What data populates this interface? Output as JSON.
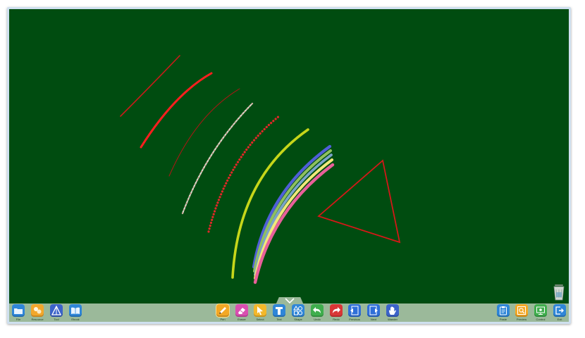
{
  "app": {
    "board_color": "#004c10",
    "toolbar_color": "#9bb99a"
  },
  "toolbar": {
    "left": [
      {
        "label": "File",
        "icon": "folder-icon",
        "color": "#2f86d8"
      },
      {
        "label": "Resource",
        "icon": "resource-icon",
        "color": "#f2a72b"
      },
      {
        "label": "Tool",
        "icon": "ruler-triangle-icon",
        "color": "#3b63c9"
      },
      {
        "label": "Ebook",
        "icon": "open-book-icon",
        "color": "#2f86d8"
      }
    ],
    "center": [
      {
        "label": "Pen",
        "icon": "pencil-icon",
        "color": "#f3a825",
        "active": true
      },
      {
        "label": "Eraser",
        "icon": "eraser-icon",
        "color": "#d94fb0"
      },
      {
        "label": "Select",
        "icon": "cursor-icon",
        "color": "#f3b82a"
      },
      {
        "label": "Text",
        "icon": "text-t-icon",
        "color": "#2f86d8"
      },
      {
        "label": "Shape",
        "icon": "shapes-icon",
        "color": "#2f86d8"
      },
      {
        "label": "Undo",
        "icon": "undo-arrow-icon",
        "color": "#3fae4d"
      },
      {
        "label": "Redo",
        "icon": "redo-arrow-icon",
        "color": "#d93636"
      },
      {
        "label": "Previous",
        "icon": "previous-page-icon",
        "color": "#2f6fd8"
      },
      {
        "label": "Next",
        "icon": "next-page-icon",
        "color": "#2f6fd8"
      },
      {
        "label": "Wander",
        "icon": "hand-icon",
        "color": "#3b63c9"
      }
    ],
    "right": [
      {
        "label": "Paste",
        "icon": "clipboard-icon",
        "color": "#2f86d8"
      },
      {
        "label": "Preview",
        "icon": "magnifier-page-icon",
        "color": "#f3a825"
      },
      {
        "label": "Control",
        "icon": "control-icon",
        "color": "#3fae4d"
      },
      {
        "label": "Exit",
        "icon": "exit-arrow-icon",
        "color": "#2f86d8"
      }
    ]
  },
  "strokes": {
    "colors": [
      "#cc1a1a",
      "#ff1e1e",
      "#b01515",
      "#d8d8c8",
      "#e02828",
      "#c6d61a",
      "#4f5fd8",
      "#8fbf5f",
      "#7aa3c9",
      "#f0e87a",
      "#e8609a",
      "#d41818"
    ]
  }
}
